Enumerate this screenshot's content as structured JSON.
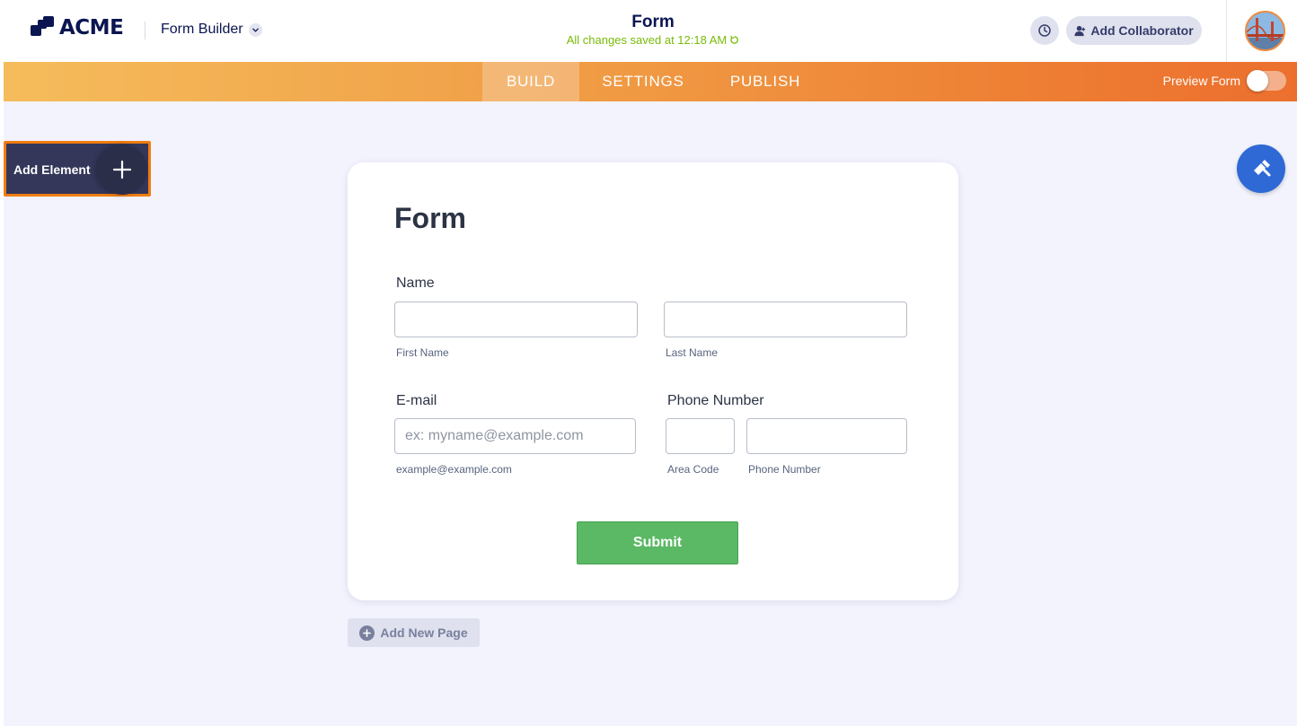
{
  "header": {
    "logo_text": "ACME",
    "app_name": "Form Builder",
    "form_title": "Form",
    "saved_status": "All changes saved at 12:18 AM",
    "collaborator_label": "Add Collaborator"
  },
  "nav": {
    "tabs": [
      {
        "label": "BUILD",
        "active": true
      },
      {
        "label": "SETTINGS",
        "active": false
      },
      {
        "label": "PUBLISH",
        "active": false
      }
    ],
    "preview_label": "Preview Form",
    "preview_enabled": false
  },
  "sidebar": {
    "add_element_label": "Add Element"
  },
  "form": {
    "title": "Form",
    "name_label": "Name",
    "first_name_sublabel": "First Name",
    "last_name_sublabel": "Last Name",
    "email_label": "E-mail",
    "email_placeholder": "ex: myname@example.com",
    "email_sublabel": "example@example.com",
    "phone_label": "Phone Number",
    "area_code_sublabel": "Area Code",
    "phone_number_sublabel": "Phone Number",
    "submit_label": "Submit"
  },
  "footer": {
    "add_page_label": "Add New Page"
  },
  "colors": {
    "brand_navy": "#0a1551",
    "saved_green": "#78bb07",
    "submit_green": "#5bb864",
    "highlight_orange": "#f27d10",
    "designer_blue": "#2e69d6"
  }
}
